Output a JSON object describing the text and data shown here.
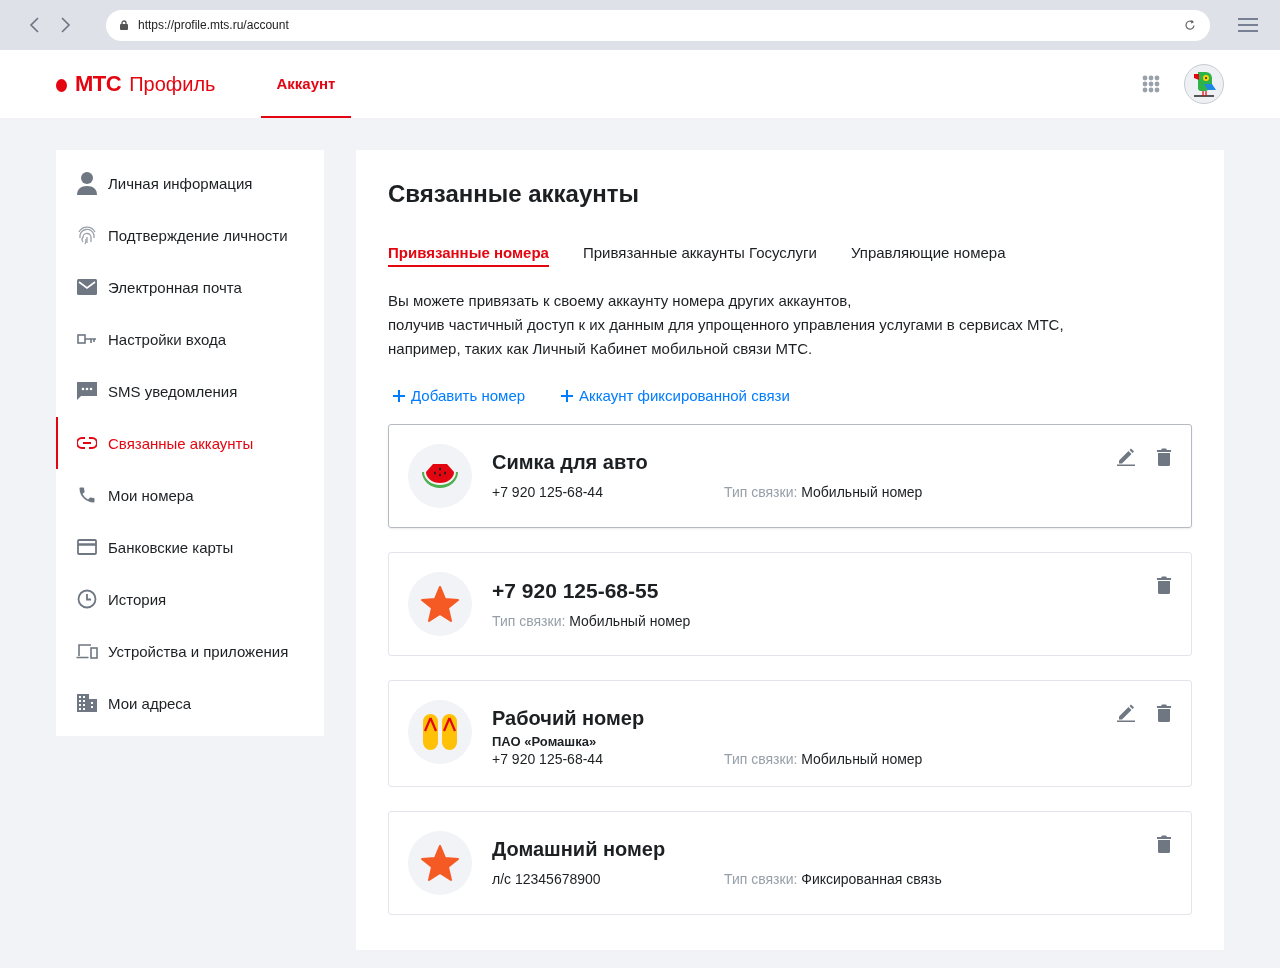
{
  "browser": {
    "url": "https://profile.mts.ru/account"
  },
  "header": {
    "logo": "МТС",
    "product": "Профиль",
    "tabs": [
      {
        "label": "Аккаунт",
        "selected": true
      }
    ]
  },
  "sidebar": {
    "items": [
      {
        "kind": "person",
        "label": "Личная информация",
        "selected": false
      },
      {
        "kind": "fingerprint",
        "label": "Подтверждение личности",
        "selected": false
      },
      {
        "kind": "mail",
        "label": "Электронная почта",
        "selected": false
      },
      {
        "kind": "key",
        "label": "Настройки входа",
        "selected": false
      },
      {
        "kind": "sms",
        "label": "SMS уведомления",
        "selected": false
      },
      {
        "kind": "link",
        "label": "Связанные аккаунты",
        "selected": true
      },
      {
        "kind": "phone",
        "label": "Мои номера",
        "selected": false
      },
      {
        "kind": "card",
        "label": "Банковские карты",
        "selected": false
      },
      {
        "kind": "clock",
        "label": "История",
        "selected": false
      },
      {
        "kind": "devices",
        "label": "Устройства и приложения",
        "selected": false
      },
      {
        "kind": "building",
        "label": "Мои адреса",
        "selected": false
      }
    ]
  },
  "main": {
    "title": "Связанные аккаунты",
    "tabs": [
      {
        "label": "Привязанные номера",
        "selected": true
      },
      {
        "label": "Привязанные аккаунты Госуслуги",
        "selected": false
      },
      {
        "label": "Управляющие номера",
        "selected": false
      }
    ],
    "description": [
      "Вы можете привязать к своему аккаунту номера других аккаунтов,",
      "получив частичный доступ к их данным для упрощенного управления услугами в сервисах МТС,",
      "например, таких как Личный Кабинет мобильной связи МТС."
    ],
    "actions": [
      "Добавить номер",
      "Аккаунт фиксированной связи"
    ],
    "accounts": [
      {
        "kind": "watermelon",
        "title": "Симка для авто",
        "detail": "+7 920 125-68-44",
        "link_type_label": "Тип связки:",
        "link_type": "Мобильный номер",
        "editable": true,
        "hovered": true
      },
      {
        "kind": "starfish",
        "title": "+7 920 125-68-55",
        "link_type_label": "Тип связки:",
        "link_type": "Мобильный номер",
        "editable": false,
        "hovered": false
      },
      {
        "kind": "flipflops",
        "title": "Рабочий номер",
        "organization": "ПАО «Ромашка»",
        "detail": "+7 920 125-68-44",
        "link_type_label": "Тип связки:",
        "link_type": "Мобильный номер",
        "editable": true,
        "hovered": false
      },
      {
        "kind": "starfish",
        "title": "Домашний номер",
        "detail": "л/с 12345678900",
        "link_type_label": "Тип связки:",
        "link_type": "Фиксированная связь",
        "editable": false,
        "hovered": false
      }
    ]
  }
}
